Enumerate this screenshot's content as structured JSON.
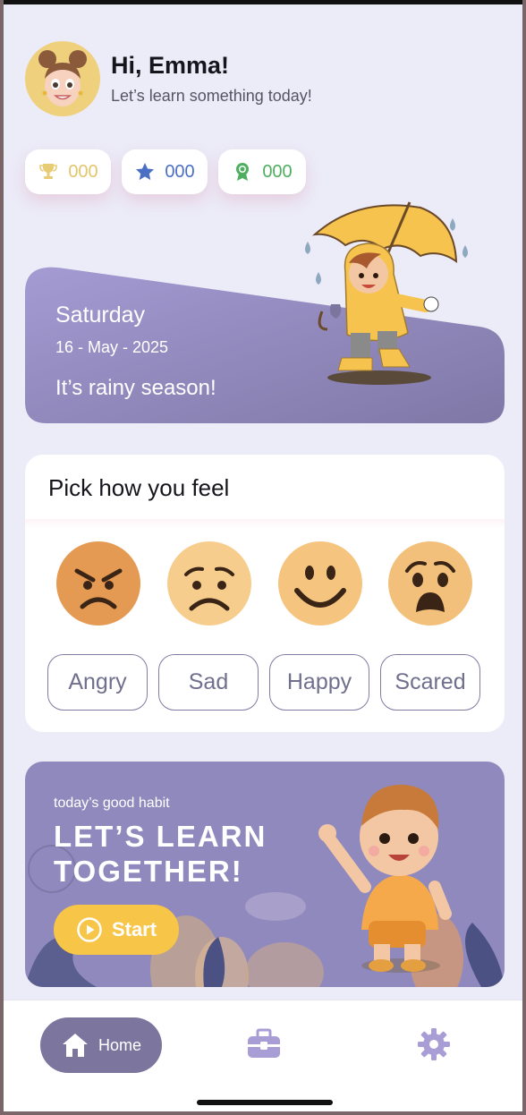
{
  "header": {
    "greeting": "Hi, Emma!",
    "subtitle": "Let’s learn something today!",
    "avatar_icon": "girl-avatar"
  },
  "stats": [
    {
      "icon": "trophy-icon",
      "value": "000",
      "color": "#e3c56b"
    },
    {
      "icon": "star-icon",
      "value": "000",
      "color": "#4b6fc4"
    },
    {
      "icon": "medal-icon",
      "value": "000",
      "color": "#4fae5f"
    }
  ],
  "weather": {
    "day": "Saturday",
    "date": "16 - May - 2025",
    "message": "It’s rainy season!",
    "illustration": "child-with-umbrella"
  },
  "feelings": {
    "title": "Pick how you feel",
    "options": [
      {
        "label": "Angry",
        "icon": "angry-face-icon"
      },
      {
        "label": "Sad",
        "icon": "sad-face-icon"
      },
      {
        "label": "Happy",
        "icon": "happy-face-icon"
      },
      {
        "label": "Scared",
        "icon": "scared-face-icon"
      }
    ]
  },
  "habit": {
    "small": "today’s good habit",
    "line1": "LET’S LEARN",
    "line2": "TOGETHER!",
    "start_label": "Start",
    "illustration": "waving-child"
  },
  "nav": {
    "home_label": "Home",
    "items": [
      "home-icon",
      "toolbox-icon",
      "gear-icon"
    ]
  },
  "colors": {
    "accent": "#7c769e",
    "background": "#ecebf8",
    "weather_card": "#9a92c8",
    "start_button": "#f7c547"
  }
}
